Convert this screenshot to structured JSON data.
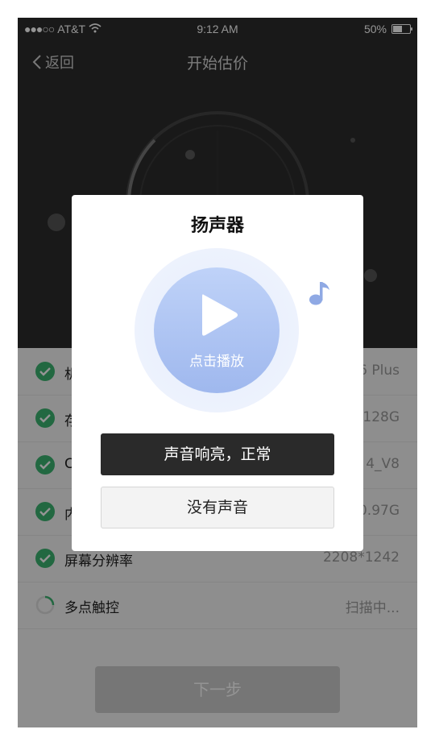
{
  "status": {
    "carrier": "AT&T",
    "time": "9:12 AM",
    "battery": "50%",
    "battery_level": 0.5
  },
  "nav": {
    "back_label": "返回",
    "title": "开始估价"
  },
  "checks": [
    {
      "name": "机",
      "value": "6 Plus",
      "state": "done"
    },
    {
      "name": "存",
      "value": "128G",
      "state": "done"
    },
    {
      "name": "C",
      "value": "4_V8",
      "state": "done"
    },
    {
      "name": "内",
      "value": "0.97G",
      "state": "done"
    },
    {
      "name": "屏幕分辨率",
      "value": "2208*1242",
      "state": "done"
    },
    {
      "name": "多点触控",
      "value": "扫描中...",
      "state": "scanning"
    }
  ],
  "next_button": "下一步",
  "modal": {
    "title": "扬声器",
    "play_label": "点击播放",
    "primary_button": "声音响亮，正常",
    "secondary_button": "没有声音"
  },
  "colors": {
    "check_green": "#3cb371",
    "play_blue": "#a9c0f0",
    "dark_button": "#2a2a2a"
  }
}
